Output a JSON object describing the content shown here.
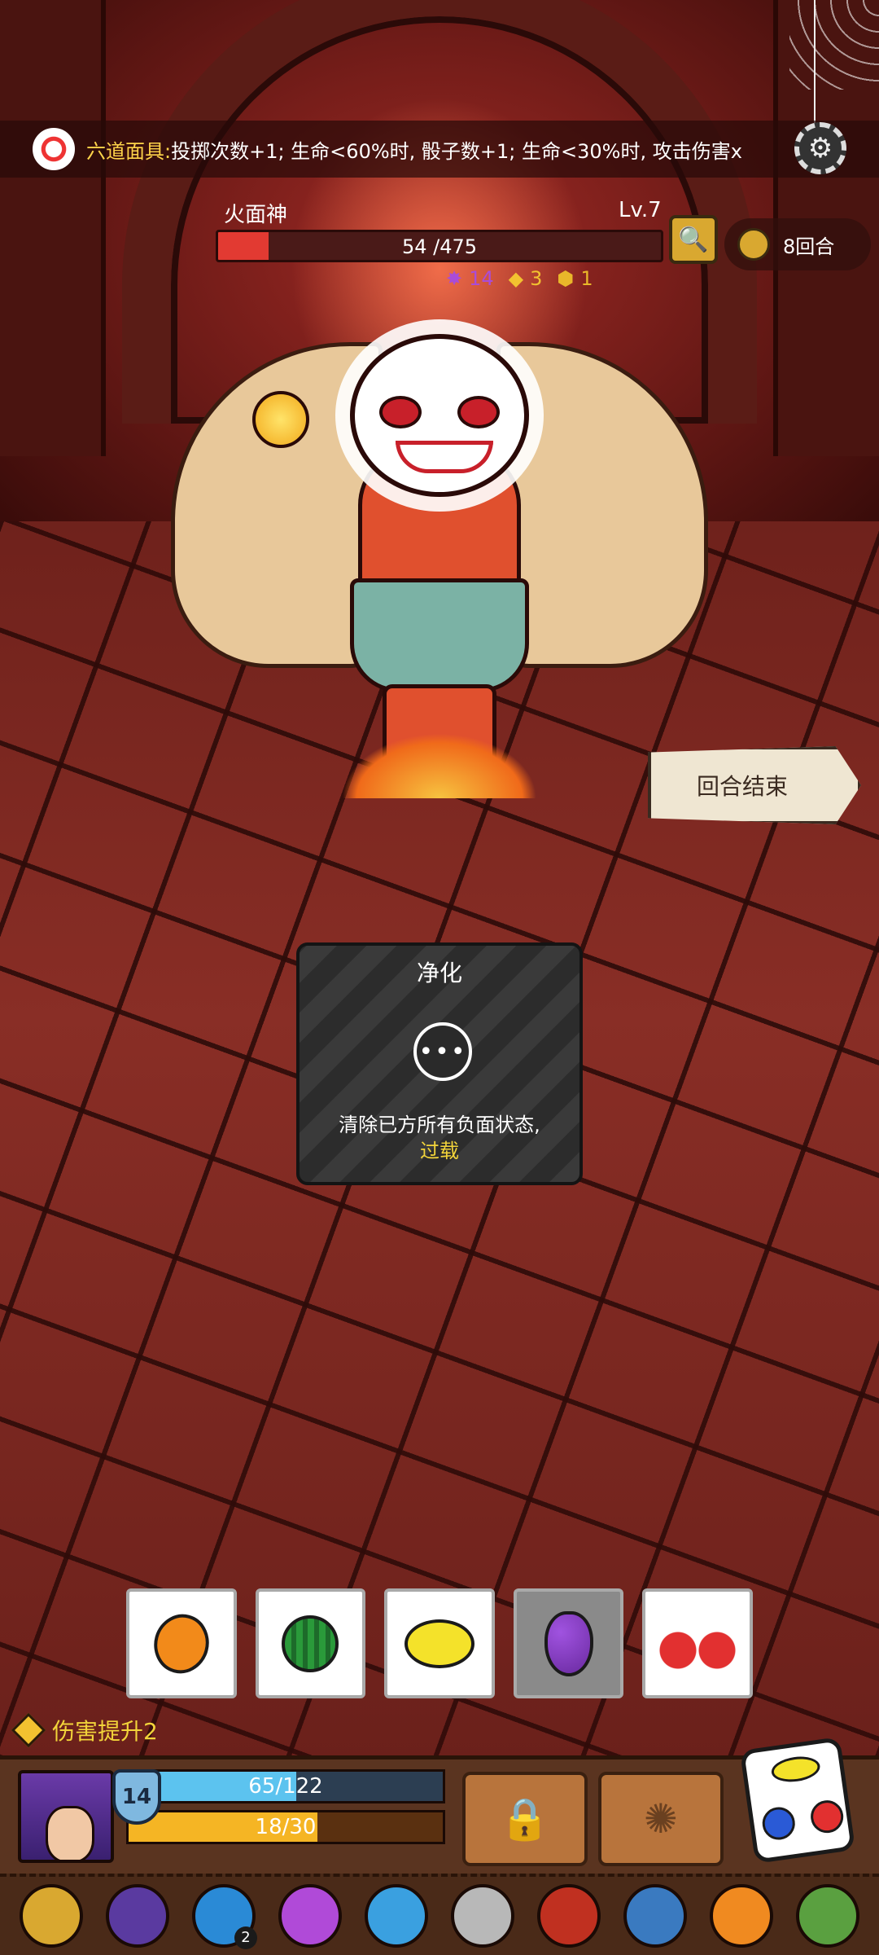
{
  "buff": {
    "title": "六道面具:",
    "text": "投掷次数+1; 生命<60%时, 骰子数+1; 生命<30%时, 攻击伤害x"
  },
  "enemy": {
    "name": "火面神",
    "level": "Lv.7",
    "hp_current": "54",
    "hp_max": "/475",
    "hp_fraction": 0.114,
    "statuses": [
      {
        "icon": "purple-splat-icon",
        "value": "14"
      },
      {
        "icon": "yellow-chevron-icon",
        "value": "3"
      },
      {
        "icon": "gold-shield-icon",
        "value": "1"
      }
    ]
  },
  "turn_counter": "8回合",
  "end_turn_label": "回合结束",
  "tooltip": {
    "title": "净化",
    "description": "清除已方所有负面状态,",
    "keyword": "过载"
  },
  "dice": [
    {
      "fruit": "orange",
      "selected": false
    },
    {
      "fruit": "watermelon",
      "selected": false
    },
    {
      "fruit": "lemon",
      "selected": false
    },
    {
      "fruit": "grape",
      "selected": true
    },
    {
      "fruit": "cherry",
      "selected": false
    }
  ],
  "damage_boost_label": "伤害提升2",
  "player": {
    "shield_value": "14",
    "hp_text": "65/122",
    "hp_fraction": 0.533,
    "xp_text": "18/30",
    "xp_fraction": 0.6
  },
  "relics": [
    {
      "icon": "golden-amulet-icon",
      "color": "#d9a830"
    },
    {
      "icon": "hexagram-icon",
      "color": "#5a3aa0"
    },
    {
      "icon": "blue-swirl-orb-icon",
      "color": "#2a8ad6",
      "badge": "2"
    },
    {
      "icon": "purple-splat-icon",
      "color": "#b04ad8"
    },
    {
      "icon": "water-drop-icon",
      "color": "#3aa0e0"
    },
    {
      "icon": "silver-ring-icon",
      "color": "#b8b8b8"
    },
    {
      "icon": "red-helmet-icon",
      "color": "#c03020"
    },
    {
      "icon": "blue-mask-icon",
      "color": "#3a7ac0"
    },
    {
      "icon": "fire-cloak-icon",
      "color": "#f08a20"
    },
    {
      "icon": "green-tablet-icon",
      "color": "#5aa040"
    }
  ]
}
